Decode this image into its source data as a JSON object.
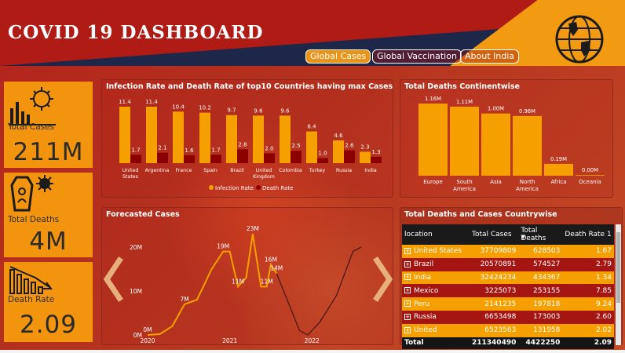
{
  "header": {
    "title": "COVID 19 DASHBOARD",
    "nav": [
      {
        "label": "Global Cases",
        "active": true
      },
      {
        "label": "Global Vaccination",
        "active": false
      },
      {
        "label": "About India",
        "active": false
      }
    ]
  },
  "kpis": {
    "total_cases": {
      "label": "Total Cases",
      "value": "211M"
    },
    "total_deaths": {
      "label": "Total Deaths",
      "value": "4M"
    },
    "death_rate": {
      "label": "Death Rate",
      "value": "2.09"
    }
  },
  "colors": {
    "accent": "#f5a000",
    "dark_red": "#8b0000",
    "brand_red": "#a51612",
    "navy": "#1d2749"
  },
  "top10_chart": {
    "title": "Infection Rate and Death Rate of top10 Countries having max Cases",
    "legend": [
      "Infection Rate",
      "Death Rate"
    ],
    "chart_data": {
      "type": "bar",
      "categories": [
        "United States",
        "Argentina",
        "France",
        "Spain",
        "Brazil",
        "United Kingdom",
        "Colombia",
        "Turkey",
        "Russia",
        "India"
      ],
      "series": [
        {
          "name": "Infection Rate",
          "values": [
            11.4,
            11.4,
            10.4,
            10.2,
            9.7,
            9.6,
            9.6,
            6.4,
            4.6,
            2.3
          ],
          "color": "#f5a000"
        },
        {
          "name": "Death Rate",
          "values": [
            1.7,
            2.1,
            1.6,
            1.7,
            2.8,
            2.0,
            2.5,
            1.0,
            2.6,
            1.3
          ],
          "color": "#8b0000"
        }
      ]
    }
  },
  "continent_chart": {
    "title": "Total Deaths Continentwise",
    "chart_data": {
      "type": "bar",
      "categories": [
        "Europe",
        "South America",
        "Asia",
        "North America",
        "Africa",
        "Oceania"
      ],
      "values": [
        1.16,
        1.11,
        1.0,
        0.96,
        0.19,
        0.0
      ],
      "labels": [
        "1.16M",
        "1.11M",
        "1.00M",
        "0.96M",
        "0.19M",
        "0.00M"
      ],
      "color": "#f5a000"
    }
  },
  "forecast_chart": {
    "title": "Forecasted Cases",
    "chart_data": {
      "type": "line",
      "y_ticks": [
        "0M",
        "10M",
        "20M"
      ],
      "x_ticks": [
        "2020",
        "2021",
        "2022"
      ],
      "actual": [
        [
          2020.0,
          0
        ],
        [
          2020.15,
          0.2
        ],
        [
          2020.3,
          2
        ],
        [
          2020.45,
          7
        ],
        [
          2020.6,
          8
        ],
        [
          2020.78,
          15
        ],
        [
          2020.92,
          19
        ],
        [
          2021.0,
          19
        ],
        [
          2021.1,
          11
        ],
        [
          2021.2,
          13
        ],
        [
          2021.28,
          23
        ],
        [
          2021.38,
          11
        ],
        [
          2021.45,
          11
        ],
        [
          2021.5,
          16
        ],
        [
          2021.57,
          14
        ]
      ],
      "forecast": [
        [
          2021.57,
          14
        ],
        [
          2021.7,
          8
        ],
        [
          2021.85,
          1
        ],
        [
          2021.95,
          0
        ],
        [
          2022.1,
          3
        ],
        [
          2022.3,
          9
        ],
        [
          2022.5,
          19
        ],
        [
          2022.6,
          20
        ]
      ],
      "point_labels": [
        {
          "x": 2020.0,
          "y": 0,
          "text": "0M"
        },
        {
          "x": 2020.45,
          "y": 7,
          "text": "7M"
        },
        {
          "x": 2020.92,
          "y": 19,
          "text": "19M"
        },
        {
          "x": 2021.1,
          "y": 11,
          "text": "11M"
        },
        {
          "x": 2021.28,
          "y": 23,
          "text": "23M"
        },
        {
          "x": 2021.45,
          "y": 11,
          "text": "11M"
        },
        {
          "x": 2021.5,
          "y": 16,
          "text": "16M"
        },
        {
          "x": 2021.57,
          "y": 14,
          "text": "14M"
        }
      ],
      "ylim": [
        0,
        25
      ]
    }
  },
  "country_table": {
    "title": "Total Deaths and Cases Countrywise",
    "columns": [
      "location",
      "Total Cases",
      "Total Deaths",
      "Death Rate 1"
    ],
    "rows": [
      {
        "location": "United States",
        "cases": "37709809",
        "deaths": "628503",
        "rate": "1.67"
      },
      {
        "location": "Brazil",
        "cases": "20570891",
        "deaths": "574527",
        "rate": "2.79"
      },
      {
        "location": "India",
        "cases": "32424234",
        "deaths": "434367",
        "rate": "1.34"
      },
      {
        "location": "Mexico",
        "cases": "3225073",
        "deaths": "253155",
        "rate": "7.85"
      },
      {
        "location": "Peru",
        "cases": "2141235",
        "deaths": "197818",
        "rate": "9.24"
      },
      {
        "location": "Russia",
        "cases": "6653498",
        "deaths": "173003",
        "rate": "2.60"
      },
      {
        "location": "United",
        "cases": "6523563",
        "deaths": "131958",
        "rate": "2.02"
      }
    ],
    "total": {
      "label": "Total",
      "cases": "211340490",
      "deaths": "4422250",
      "rate": "2.09"
    }
  }
}
